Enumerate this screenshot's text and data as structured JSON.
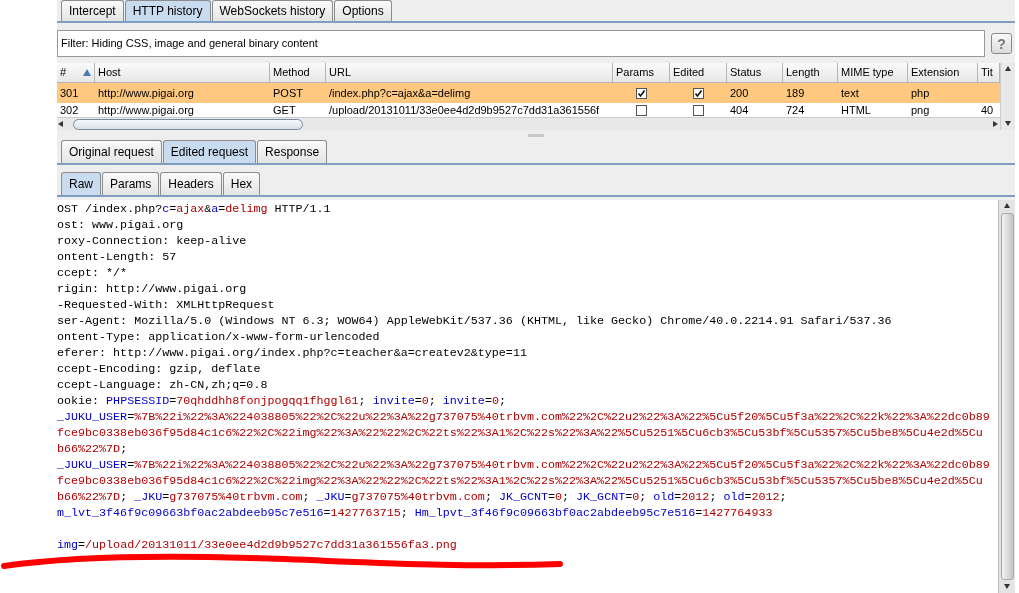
{
  "main_tabs": [
    {
      "label": "Intercept",
      "selected": false
    },
    {
      "label": "HTTP history",
      "selected": true
    },
    {
      "label": "WebSockets history",
      "selected": false
    },
    {
      "label": "Options",
      "selected": false
    }
  ],
  "filter": {
    "text": "Filter:  Hiding CSS, image and general binary content",
    "help": "?"
  },
  "table": {
    "columns": [
      {
        "label": "#",
        "sorted": true
      },
      {
        "label": "Host",
        "sorted": false
      },
      {
        "label": "Method",
        "sorted": false
      },
      {
        "label": "URL",
        "sorted": false
      },
      {
        "label": "Params",
        "sorted": false
      },
      {
        "label": "Edited",
        "sorted": false
      },
      {
        "label": "Status",
        "sorted": false
      },
      {
        "label": "Length",
        "sorted": false
      },
      {
        "label": "MIME type",
        "sorted": false
      },
      {
        "label": "Extension",
        "sorted": false
      },
      {
        "label": "Tit",
        "sorted": false
      }
    ],
    "rows": [
      {
        "selected": true,
        "cells": [
          {
            "text": "301"
          },
          {
            "text": "http://www.pigai.org"
          },
          {
            "text": "POST"
          },
          {
            "text": "/index.php?c=ajax&a=delimg"
          },
          {
            "checked": true
          },
          {
            "checked": true
          },
          {
            "text": "200"
          },
          {
            "text": "189"
          },
          {
            "text": "text"
          },
          {
            "text": "php"
          }
        ]
      },
      {
        "selected": false,
        "cells": [
          {
            "text": "302"
          },
          {
            "text": "http://www.pigai.org"
          },
          {
            "text": "GET"
          },
          {
            "text": "/upload/20131011/33e0ee4d2d9b9527c7dd31a361556f"
          },
          {
            "checked": false
          },
          {
            "checked": false
          },
          {
            "text": "404"
          },
          {
            "text": "724"
          },
          {
            "text": "HTML"
          },
          {
            "text": "png"
          },
          {
            "text": "40"
          }
        ]
      }
    ]
  },
  "message_tabs": [
    {
      "label": "Original request",
      "selected": false
    },
    {
      "label": "Edited request",
      "selected": true
    },
    {
      "label": "Response",
      "selected": false
    }
  ],
  "view_tabs": [
    {
      "label": "Raw",
      "selected": true
    },
    {
      "label": "Params",
      "selected": false
    },
    {
      "label": "Headers",
      "selected": false
    },
    {
      "label": "Hex",
      "selected": false
    }
  ],
  "request_lines": [
    {
      "segments": [
        {
          "kind": "plain",
          "text": "OST /index.php?"
        },
        {
          "kind": "name",
          "text": "c"
        },
        {
          "kind": "plain",
          "text": "="
        },
        {
          "kind": "value",
          "text": "ajax"
        },
        {
          "kind": "plain",
          "text": "&"
        },
        {
          "kind": "name",
          "text": "a"
        },
        {
          "kind": "plain",
          "text": "="
        },
        {
          "kind": "value",
          "text": "delimg"
        },
        {
          "kind": "plain",
          "text": " HTTP/1.1"
        }
      ]
    },
    {
      "segments": [
        {
          "kind": "plain",
          "text": "ost: www.pigai.org"
        }
      ]
    },
    {
      "segments": [
        {
          "kind": "plain",
          "text": "roxy-Connection: keep-alive"
        }
      ]
    },
    {
      "segments": [
        {
          "kind": "plain",
          "text": "ontent-Length: 57"
        }
      ]
    },
    {
      "segments": [
        {
          "kind": "plain",
          "text": "ccept: */*"
        }
      ]
    },
    {
      "segments": [
        {
          "kind": "plain",
          "text": "rigin: http://www.pigai.org"
        }
      ]
    },
    {
      "segments": [
        {
          "kind": "plain",
          "text": "-Requested-With: XMLHttpRequest"
        }
      ]
    },
    {
      "segments": [
        {
          "kind": "plain",
          "text": "ser-Agent: Mozilla/5.0 (Windows NT 6.3; WOW64) AppleWebKit/537.36 (KHTML, like Gecko) Chrome/40.0.2214.91 Safari/537.36"
        }
      ]
    },
    {
      "segments": [
        {
          "kind": "plain",
          "text": "ontent-Type: application/x-www-form-urlencoded"
        }
      ]
    },
    {
      "segments": [
        {
          "kind": "plain",
          "text": "eferer: http://www.pigai.org/index.php?c=teacher&a=createv2&type=11"
        }
      ]
    },
    {
      "segments": [
        {
          "kind": "plain",
          "text": "ccept-Encoding: gzip, deflate"
        }
      ]
    },
    {
      "segments": [
        {
          "kind": "plain",
          "text": "ccept-Language: zh-CN,zh;q=0.8"
        }
      ]
    },
    {
      "segments": [
        {
          "kind": "plain",
          "text": "ookie: "
        },
        {
          "kind": "name",
          "text": "PHPSESSID"
        },
        {
          "kind": "plain",
          "text": "="
        },
        {
          "kind": "value",
          "text": "70qhddhh8fonjpogqq1fhggl61"
        },
        {
          "kind": "plain",
          "text": "; "
        },
        {
          "kind": "name",
          "text": "invite"
        },
        {
          "kind": "plain",
          "text": "="
        },
        {
          "kind": "value",
          "text": "0"
        },
        {
          "kind": "plain",
          "text": "; "
        },
        {
          "kind": "name",
          "text": "invite"
        },
        {
          "kind": "plain",
          "text": "="
        },
        {
          "kind": "value",
          "text": "0"
        },
        {
          "kind": "plain",
          "text": ";"
        }
      ]
    },
    {
      "segments": [
        {
          "kind": "name",
          "text": "_JUKU_USER"
        },
        {
          "kind": "plain",
          "text": "="
        },
        {
          "kind": "value",
          "text": "%7B%22i%22%3A%224038805%22%2C%22u%22%3A%22g737075%40trbvm.com%22%2C%22u2%22%3A%22%5Cu5f20%5Cu5f3a%22%2C%22k%22%3A%22dc0b89"
        }
      ]
    },
    {
      "segments": [
        {
          "kind": "value",
          "text": "fce9bc0338eb036f95d84c1c6%22%2C%22img%22%3A%22%22%2C%22ts%22%3A1%2C%22s%22%3A%22%5Cu5251%5Cu6cb3%5Cu53bf%5Cu5357%5Cu5be8%5Cu4e2d%5Cu"
        }
      ]
    },
    {
      "segments": [
        {
          "kind": "value",
          "text": "b66%22%7D"
        },
        {
          "kind": "plain",
          "text": ";"
        }
      ]
    },
    {
      "segments": [
        {
          "kind": "name",
          "text": "_JUKU_USER"
        },
        {
          "kind": "plain",
          "text": "="
        },
        {
          "kind": "value",
          "text": "%7B%22i%22%3A%224038805%22%2C%22u%22%3A%22g737075%40trbvm.com%22%2C%22u2%22%3A%22%5Cu5f20%5Cu5f3a%22%2C%22k%22%3A%22dc0b89"
        }
      ]
    },
    {
      "segments": [
        {
          "kind": "value",
          "text": "fce9bc0338eb036f95d84c1c6%22%2C%22img%22%3A%22%22%2C%22ts%22%3A1%2C%22s%22%3A%22%5Cu5251%5Cu6cb3%5Cu53bf%5Cu5357%5Cu5be8%5Cu4e2d%5Cu"
        }
      ]
    },
    {
      "segments": [
        {
          "kind": "value",
          "text": "b66%22%7D"
        },
        {
          "kind": "plain",
          "text": "; "
        },
        {
          "kind": "name",
          "text": "_JKU"
        },
        {
          "kind": "plain",
          "text": "="
        },
        {
          "kind": "value",
          "text": "g737075%40trbvm.com"
        },
        {
          "kind": "plain",
          "text": "; "
        },
        {
          "kind": "name",
          "text": "_JKU"
        },
        {
          "kind": "plain",
          "text": "="
        },
        {
          "kind": "value",
          "text": "g737075%40trbvm.com"
        },
        {
          "kind": "plain",
          "text": "; "
        },
        {
          "kind": "name",
          "text": "JK_GCNT"
        },
        {
          "kind": "plain",
          "text": "="
        },
        {
          "kind": "value",
          "text": "0"
        },
        {
          "kind": "plain",
          "text": "; "
        },
        {
          "kind": "name",
          "text": "JK_GCNT"
        },
        {
          "kind": "plain",
          "text": "="
        },
        {
          "kind": "value",
          "text": "0"
        },
        {
          "kind": "plain",
          "text": "; "
        },
        {
          "kind": "name",
          "text": "old"
        },
        {
          "kind": "plain",
          "text": "="
        },
        {
          "kind": "value",
          "text": "2012"
        },
        {
          "kind": "plain",
          "text": "; "
        },
        {
          "kind": "name",
          "text": "old"
        },
        {
          "kind": "plain",
          "text": "="
        },
        {
          "kind": "value",
          "text": "2012"
        },
        {
          "kind": "plain",
          "text": ";"
        }
      ]
    },
    {
      "segments": [
        {
          "kind": "name",
          "text": "m_lvt_3f46f9c09663bf0ac2abdeeb95c7e516"
        },
        {
          "kind": "plain",
          "text": "="
        },
        {
          "kind": "value",
          "text": "1427763715"
        },
        {
          "kind": "plain",
          "text": "; "
        },
        {
          "kind": "name",
          "text": "Hm_lpvt_3f46f9c09663bf0ac2abdeeb95c7e516"
        },
        {
          "kind": "plain",
          "text": "="
        },
        {
          "kind": "value",
          "text": "1427764933"
        }
      ]
    },
    {
      "kind": "blank"
    },
    {
      "segments": [
        {
          "kind": "name",
          "text": "img"
        },
        {
          "kind": "plain",
          "text": "="
        },
        {
          "kind": "value",
          "text": "/upload/20131011/33e0ee4d2d9b9527c7dd31a361556fa3.png"
        }
      ]
    }
  ]
}
